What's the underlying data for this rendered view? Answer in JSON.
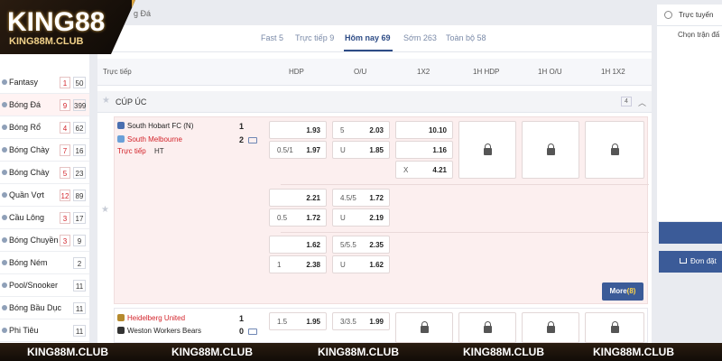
{
  "logo": {
    "brand": "KING88",
    "url": "KING88M.CLUB"
  },
  "breadcrumb": "g Đá",
  "tabs": [
    {
      "label": "Fast 5"
    },
    {
      "label": "Trực tiếp 9"
    },
    {
      "label": "Hôm nay 69"
    },
    {
      "label": "Sớm 263"
    },
    {
      "label": "Toàn bộ 58"
    }
  ],
  "columns": [
    "Trực tiếp",
    "HDP",
    "O/U",
    "1X2",
    "1H HDP",
    "1H O/U",
    "1H 1X2"
  ],
  "sidebar": {
    "items": [
      {
        "label": "Fantasy",
        "live": "1",
        "total": "50"
      },
      {
        "label": "Bóng Đá",
        "live": "9",
        "total": "399"
      },
      {
        "label": "Bóng Rổ",
        "live": "4",
        "total": "62"
      },
      {
        "label": "Bóng Chày",
        "live": "7",
        "total": "16"
      },
      {
        "label": "Bóng Chày",
        "live": "5",
        "total": "23"
      },
      {
        "label": "Quần Vợt",
        "live": "12",
        "total": "89"
      },
      {
        "label": "Cầu Lông",
        "live": "3",
        "total": "17"
      },
      {
        "label": "Bóng Chuyền",
        "live": "3",
        "total": "9"
      },
      {
        "label": "Bóng Ném",
        "live": "",
        "total": "2"
      },
      {
        "label": "Pool/Snooker",
        "live": "",
        "total": "11"
      },
      {
        "label": "Bóng Bầu Dục",
        "live": "",
        "total": "11"
      },
      {
        "label": "Phi Tiêu",
        "live": "",
        "total": "11"
      }
    ]
  },
  "league": {
    "name": "CÚP ÚC",
    "count": "4"
  },
  "match1": {
    "home": "South Hobart FC (N)",
    "away": "South Melbourne",
    "home_score": "1",
    "away_score": "2",
    "status": "Trực tiếp",
    "period": "HT",
    "rows": [
      {
        "hdp_line_home": "",
        "hdp_home": "1.93",
        "hdp_line_away": "0.5/1",
        "hdp_away": "1.97",
        "ou_line": "5",
        "ou_over": "2.03",
        "ou_u": "U",
        "ou_under": "1.85",
        "x1": "10.10",
        "x2": "1.16",
        "xx_label": "X",
        "xx": "4.21"
      },
      {
        "hdp_line_home": "",
        "hdp_home": "2.21",
        "hdp_line_away": "0.5",
        "hdp_away": "1.72",
        "ou_line": "4.5/5",
        "ou_over": "1.72",
        "ou_u": "U",
        "ou_under": "2.19"
      },
      {
        "hdp_line_home": "",
        "hdp_home": "1.62",
        "hdp_line_away": "1",
        "hdp_away": "2.38",
        "ou_line": "5/5.5",
        "ou_over": "2.35",
        "ou_u": "U",
        "ou_under": "1.62"
      }
    ],
    "more_label": "More",
    "more_count": "(8)"
  },
  "match2": {
    "home": "Heidelberg United",
    "away": "Weston Workers Bears",
    "home_score": "1",
    "away_score": "0",
    "hdp_line": "1.5",
    "hdp_home": "1.95",
    "ou_line": "3/3.5",
    "ou_over": "1.99"
  },
  "right_panel": {
    "live_label": "Trực tuyến",
    "choose_label": "Chọn trận đấ",
    "order_label": "Đơn đặt"
  },
  "footer": [
    "KING88M.CLUB",
    "KING88M.CLUB",
    "KING88M.CLUB",
    "KING88M.CLUB",
    "KING88M.CLUB"
  ],
  "colors": {
    "brand_blue": "#3b5b98",
    "live_red": "#d3242b",
    "gold": "#d9a441"
  }
}
